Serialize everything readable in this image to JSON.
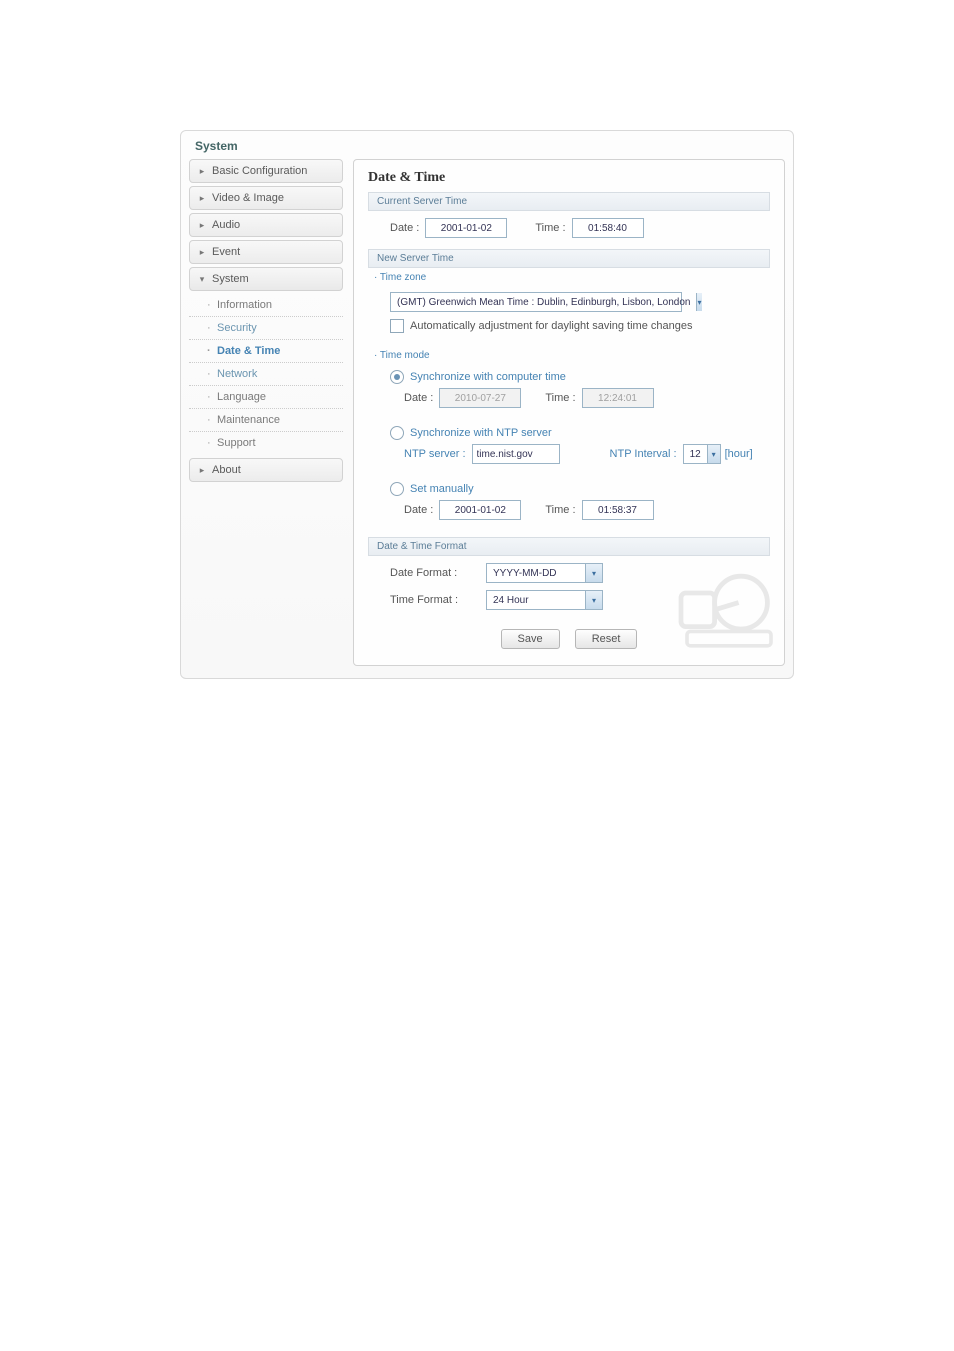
{
  "window": {
    "title": "System"
  },
  "sidebar": {
    "groups": [
      {
        "label": "Basic Configuration",
        "expanded": false
      },
      {
        "label": "Video & Image",
        "expanded": false
      },
      {
        "label": "Audio",
        "expanded": false
      },
      {
        "label": "Event",
        "expanded": false
      },
      {
        "label": "System",
        "expanded": true,
        "items": [
          {
            "label": "Information",
            "selected": false
          },
          {
            "label": "Security",
            "selected": false,
            "is_group": true
          },
          {
            "label": "Date & Time",
            "selected": true
          },
          {
            "label": "Network",
            "selected": false,
            "is_group": true
          },
          {
            "label": "Language",
            "selected": false
          },
          {
            "label": "Maintenance",
            "selected": false
          },
          {
            "label": "Support",
            "selected": false
          }
        ]
      },
      {
        "label": "About",
        "expanded": false
      }
    ]
  },
  "page": {
    "title": "Date & Time",
    "current_server_time": {
      "heading": "Current Server Time",
      "date_label": "Date :",
      "date_value": "2001-01-02",
      "time_label": "Time :",
      "time_value": "01:58:40"
    },
    "new_server_time": {
      "heading": "New Server Time",
      "timezone_heading": "· Time zone",
      "timezone_value": "(GMT) Greenwich Mean Time : Dublin, Edinburgh, Lisbon, London",
      "dst_checkbox_label": "Automatically adjustment for daylight saving time changes",
      "dst_checked": false,
      "timemode_heading": "· Time mode",
      "modes": {
        "computer": {
          "label": "Synchronize with computer time",
          "selected": true,
          "date_label": "Date :",
          "date_value": "2010-07-27",
          "time_label": "Time :",
          "time_value": "12:24:01"
        },
        "ntp": {
          "label": "Synchronize with NTP server",
          "selected": false,
          "server_label": "NTP server :",
          "server_value": "time.nist.gov",
          "interval_label": "NTP Interval :",
          "interval_value": "12",
          "interval_unit": "[hour]"
        },
        "manual": {
          "label": "Set manually",
          "selected": false,
          "date_label": "Date :",
          "date_value": "2001-01-02",
          "time_label": "Time :",
          "time_value": "01:58:37"
        }
      }
    },
    "format": {
      "heading": "Date & Time Format",
      "date_format_label": "Date Format :",
      "date_format_value": "YYYY-MM-DD",
      "time_format_label": "Time Format :",
      "time_format_value": "24 Hour"
    },
    "buttons": {
      "save": "Save",
      "reset": "Reset"
    }
  }
}
